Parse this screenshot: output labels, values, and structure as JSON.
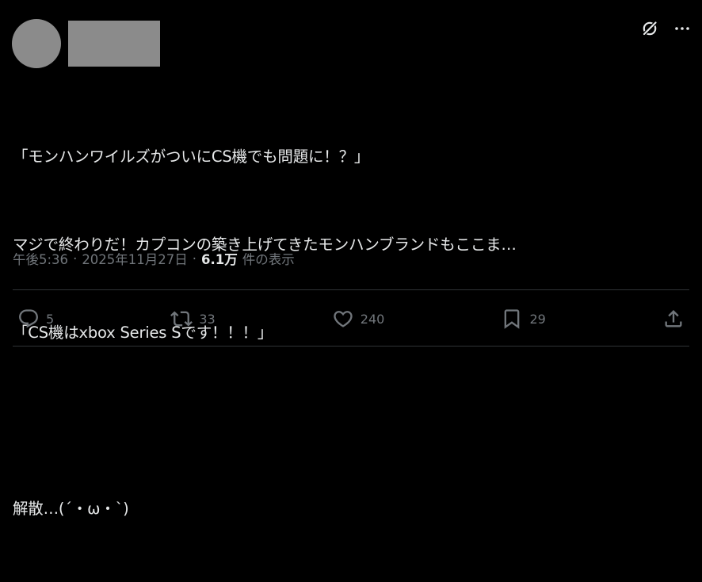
{
  "tweet": {
    "lines": [
      "「モンハンワイルズがついにCS機でも問題に！？」",
      "マジで終わりだ！カプコンの築き上げてきたモンハンブランドもここま…",
      "「CS機はxbox Series Sです！！！」",
      "",
      "解散…(´・ω・`)"
    ]
  },
  "meta": {
    "time": "午後5:36",
    "separator": "·",
    "date": "2025年11月27日",
    "views_count": "6.1万",
    "views_label": "件の表示"
  },
  "actions": {
    "replies": "5",
    "reposts": "33",
    "likes": "240",
    "bookmarks": "29"
  },
  "icons": {
    "top": [
      "grok-icon",
      "more-icon"
    ],
    "actions": [
      "reply-icon",
      "repost-icon",
      "like-icon",
      "bookmark-icon",
      "share-icon"
    ]
  },
  "colors": {
    "background": "#000000",
    "text": "#e7e9ea",
    "secondary": "#71767b",
    "divider": "#2f3336",
    "placeholder": "#8b8b8b"
  }
}
